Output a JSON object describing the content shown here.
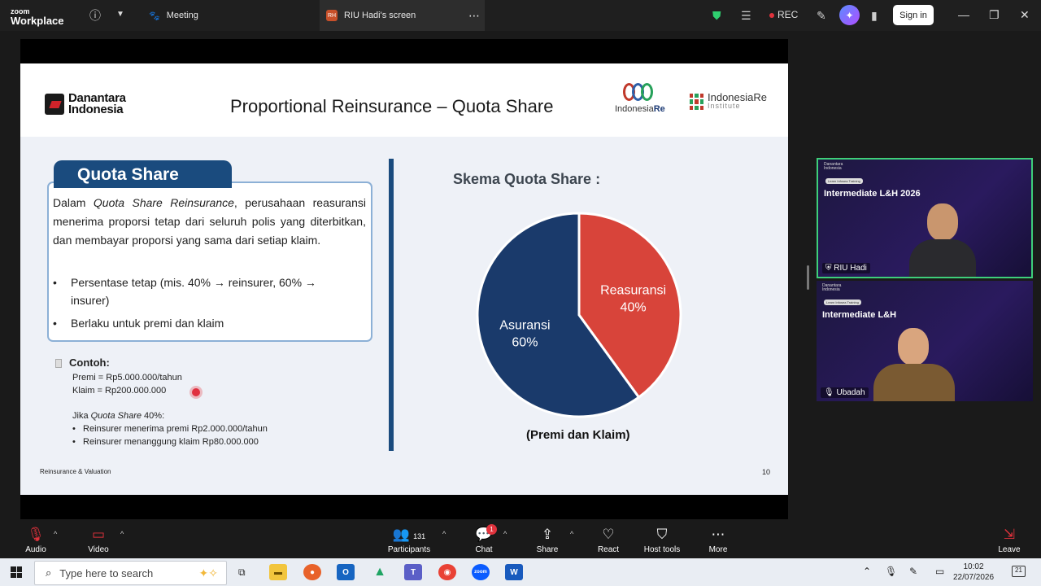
{
  "zoom": {
    "logo_top": "zoom",
    "logo_bottom": "Workplace",
    "meeting_label": "Meeting",
    "share_tab": {
      "initials": "RH",
      "label": "RIU Hadi's screen"
    },
    "rec_label": "REC",
    "sign_in": "Sign in"
  },
  "slide": {
    "logo_left_line1": "Danantara",
    "logo_left_line2": "Indonesia",
    "title": "Proportional Reinsurance – Quota Share",
    "logo_right1_a": "Indonesia",
    "logo_right1_b": "Re",
    "logo_right2": "IndonesiaRe",
    "logo_right2_sub": "Institute",
    "box_title": "Quota Share",
    "box_para_pre": "Dalam ",
    "box_para_em": "Quota Share Reinsurance",
    "box_para_post": ", perusahaan reasuransi menerima proporsi tetap dari seluruh polis yang diterbitkan, dan membayar proporsi yang sama dari setiap klaim.",
    "bullet1": "Persentase tetap (mis. 40% → reinsurer, 60% → insurer)",
    "bullet2": "Berlaku untuk premi dan klaim",
    "contoh_label": "Contoh:",
    "premi": "Premi = Rp5.000.000/tahun",
    "klaim": "Klaim = Rp200.000.000",
    "jika_pre": "Jika ",
    "jika_em": "Quota Share",
    "jika_post": " 40%:",
    "sub1": "Reinsurer menerima premi Rp2.000.000/tahun",
    "sub2": "Reinsurer menanggung klaim Rp80.000.000",
    "skema_title": "Skema Quota Share :",
    "caption": "(Premi dan Klaim)",
    "footer_left": "Reinsurance & Valuation",
    "page_number": "10"
  },
  "chart_data": {
    "type": "pie",
    "slices": [
      {
        "label": "Reasuransi",
        "value": 40,
        "value_label": "40%",
        "color": "#d8443a"
      },
      {
        "label": "Asuransi",
        "value": 60,
        "value_label": "60%",
        "color": "#1a3a6b"
      }
    ],
    "title": "Skema Quota Share :",
    "caption": "(Premi dan Klaim)"
  },
  "participants_tiles": [
    {
      "header1": "Danantara",
      "header2": "Indonesia",
      "tag": "Learn Infosea Training",
      "title": "Intermediate L&H 2026",
      "name": "RIU Hadi",
      "active": true
    },
    {
      "header1": "Danantara",
      "header2": "Indonesia",
      "tag": "Learn Infosea Training",
      "title": "Intermediate L&H",
      "name": "Ubadah",
      "active": false
    }
  ],
  "controls": {
    "audio": "Audio",
    "video": "Video",
    "participants": "Participants",
    "participants_count": "131",
    "chat": "Chat",
    "chat_badge": "1",
    "share": "Share",
    "react": "React",
    "host_tools": "Host tools",
    "more": "More",
    "leave": "Leave"
  },
  "taskbar": {
    "search_placeholder": "Type here to search",
    "time": "10:02",
    "date": "22/07/2026",
    "notification_count": "21"
  },
  "colors": {
    "accent_navy": "#1a4b7e",
    "zoom_bar": "#1f1f1f",
    "active_tile_border": "#3ecf7a",
    "rec_red": "#e0323c"
  }
}
